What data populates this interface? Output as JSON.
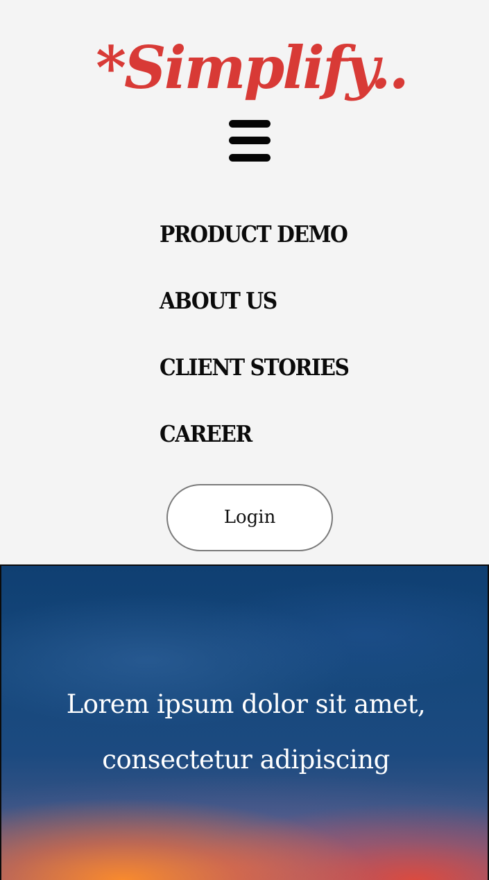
{
  "brand": {
    "logo_text": "*Simplify..",
    "logo_color": "#d83a36"
  },
  "menu": {
    "toggle_icon": "hamburger-menu-icon",
    "items": [
      {
        "label": "PRODUCT DEMO"
      },
      {
        "label": "ABOUT US"
      },
      {
        "label": "CLIENT STORIES"
      },
      {
        "label": "CAREER"
      }
    ],
    "login_label": "Login"
  },
  "hero": {
    "line1": "Lorem ipsum dolor sit amet,",
    "line2": "consectetur adipiscing"
  }
}
